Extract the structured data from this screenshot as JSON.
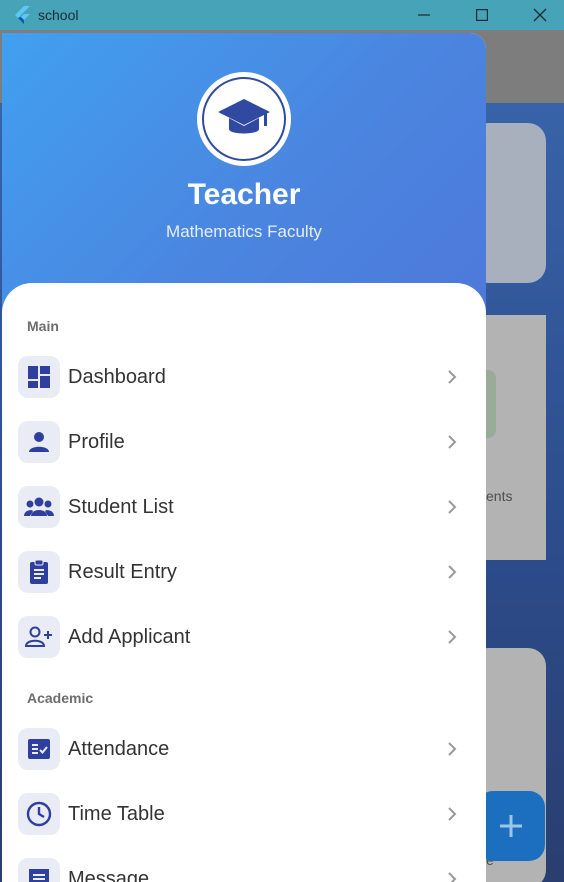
{
  "window": {
    "title": "school"
  },
  "header": {
    "name": "Teacher",
    "role": "Mathematics Faculty"
  },
  "sections": [
    {
      "label": "Main",
      "items": [
        {
          "label": "Dashboard",
          "icon": "dashboard-icon"
        },
        {
          "label": "Profile",
          "icon": "person-icon"
        },
        {
          "label": "Student List",
          "icon": "group-icon"
        },
        {
          "label": "Result Entry",
          "icon": "clipboard-icon"
        },
        {
          "label": "Add Applicant",
          "icon": "person-add-icon"
        }
      ]
    },
    {
      "label": "Academic",
      "items": [
        {
          "label": "Attendance",
          "icon": "checklist-icon"
        },
        {
          "label": "Time Table",
          "icon": "clock-icon"
        },
        {
          "label": "Message",
          "icon": "message-icon"
        }
      ]
    }
  ],
  "background": {
    "card2_text": "ents",
    "card3_text": "e"
  },
  "colors": {
    "accent": "#2f3f9e",
    "header_start": "#41a0f0",
    "header_end": "#4e78da",
    "titlebar": "#47a3b7",
    "fab": "#1c6fbf"
  }
}
